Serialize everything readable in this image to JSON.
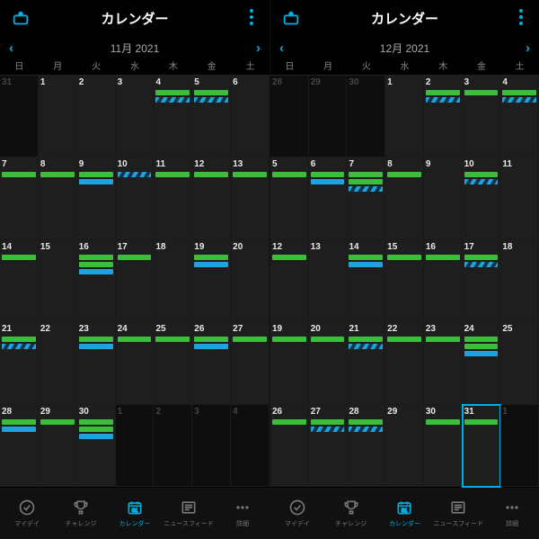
{
  "header_title": "カレンダー",
  "weekdays": [
    "日",
    "月",
    "火",
    "水",
    "木",
    "金",
    "土"
  ],
  "tabs": [
    "マイデイ",
    "チャレンジ",
    "カレンダー",
    "ニュースフィード",
    "詳細"
  ],
  "active_tab_index": 2,
  "colors": {
    "green": "#3bbf3b",
    "blue": "#1ea3e0",
    "accent": "#00aee0"
  },
  "panels": [
    {
      "month_label": "11月 2021",
      "today": null,
      "cells": [
        {
          "d": 31,
          "out": true,
          "bars": []
        },
        {
          "d": 1,
          "bars": []
        },
        {
          "d": 2,
          "bars": []
        },
        {
          "d": 3,
          "bars": []
        },
        {
          "d": 4,
          "bars": [
            "green",
            "stripe"
          ]
        },
        {
          "d": 5,
          "bars": [
            "green",
            "stripe"
          ]
        },
        {
          "d": 6,
          "bars": []
        },
        {
          "d": 7,
          "bars": [
            "green"
          ]
        },
        {
          "d": 8,
          "bars": [
            "green"
          ]
        },
        {
          "d": 9,
          "bars": [
            "green",
            "blue"
          ]
        },
        {
          "d": 10,
          "bars": [
            "stripe"
          ]
        },
        {
          "d": 11,
          "bars": [
            "green"
          ]
        },
        {
          "d": 12,
          "bars": [
            "green"
          ]
        },
        {
          "d": 13,
          "bars": [
            "green"
          ]
        },
        {
          "d": 14,
          "bars": [
            "green"
          ]
        },
        {
          "d": 15,
          "bars": []
        },
        {
          "d": 16,
          "bars": [
            "green",
            "green",
            "blue"
          ]
        },
        {
          "d": 17,
          "bars": [
            "green"
          ]
        },
        {
          "d": 18,
          "bars": []
        },
        {
          "d": 19,
          "bars": [
            "green",
            "blue"
          ]
        },
        {
          "d": 20,
          "bars": []
        },
        {
          "d": 21,
          "bars": [
            "green",
            "stripe"
          ]
        },
        {
          "d": 22,
          "bars": []
        },
        {
          "d": 23,
          "bars": [
            "green",
            "blue"
          ]
        },
        {
          "d": 24,
          "bars": [
            "green"
          ]
        },
        {
          "d": 25,
          "bars": [
            "green"
          ]
        },
        {
          "d": 26,
          "bars": [
            "green",
            "blue"
          ]
        },
        {
          "d": 27,
          "bars": [
            "green"
          ]
        },
        {
          "d": 28,
          "bars": [
            "green",
            "blue"
          ]
        },
        {
          "d": 29,
          "bars": [
            "green"
          ]
        },
        {
          "d": 30,
          "bars": [
            "green",
            "green",
            "blue"
          ]
        },
        {
          "d": 1,
          "out": true,
          "bars": []
        },
        {
          "d": 2,
          "out": true,
          "bars": []
        },
        {
          "d": 3,
          "out": true,
          "bars": []
        },
        {
          "d": 4,
          "out": true,
          "bars": []
        }
      ]
    },
    {
      "month_label": "12月 2021",
      "today": 31,
      "cells": [
        {
          "d": 28,
          "out": true,
          "bars": []
        },
        {
          "d": 29,
          "out": true,
          "bars": []
        },
        {
          "d": 30,
          "out": true,
          "bars": []
        },
        {
          "d": 1,
          "bars": []
        },
        {
          "d": 2,
          "bars": [
            "green",
            "stripe"
          ]
        },
        {
          "d": 3,
          "bars": [
            "green"
          ]
        },
        {
          "d": 4,
          "bars": [
            "green",
            "stripe"
          ]
        },
        {
          "d": 5,
          "bars": [
            "green"
          ]
        },
        {
          "d": 6,
          "bars": [
            "green",
            "blue"
          ]
        },
        {
          "d": 7,
          "bars": [
            "green",
            "green",
            "stripe"
          ]
        },
        {
          "d": 8,
          "bars": [
            "green"
          ]
        },
        {
          "d": 9,
          "bars": []
        },
        {
          "d": 10,
          "bars": [
            "green",
            "stripe"
          ]
        },
        {
          "d": 11,
          "bars": []
        },
        {
          "d": 12,
          "bars": [
            "green"
          ]
        },
        {
          "d": 13,
          "bars": []
        },
        {
          "d": 14,
          "bars": [
            "green",
            "blue"
          ]
        },
        {
          "d": 15,
          "bars": [
            "green"
          ]
        },
        {
          "d": 16,
          "bars": [
            "green"
          ]
        },
        {
          "d": 17,
          "bars": [
            "green",
            "stripe"
          ]
        },
        {
          "d": 18,
          "bars": []
        },
        {
          "d": 19,
          "bars": [
            "green"
          ]
        },
        {
          "d": 20,
          "bars": [
            "green"
          ]
        },
        {
          "d": 21,
          "bars": [
            "green",
            "stripe"
          ]
        },
        {
          "d": 22,
          "bars": [
            "green"
          ]
        },
        {
          "d": 23,
          "bars": [
            "green"
          ]
        },
        {
          "d": 24,
          "bars": [
            "green",
            "green",
            "blue"
          ]
        },
        {
          "d": 25,
          "bars": []
        },
        {
          "d": 26,
          "bars": [
            "green"
          ]
        },
        {
          "d": 27,
          "bars": [
            "green",
            "stripe"
          ]
        },
        {
          "d": 28,
          "bars": [
            "green",
            "stripe"
          ]
        },
        {
          "d": 29,
          "bars": []
        },
        {
          "d": 30,
          "bars": [
            "green"
          ]
        },
        {
          "d": 31,
          "bars": [
            "green"
          ]
        },
        {
          "d": 1,
          "out": true,
          "bars": []
        }
      ]
    }
  ]
}
